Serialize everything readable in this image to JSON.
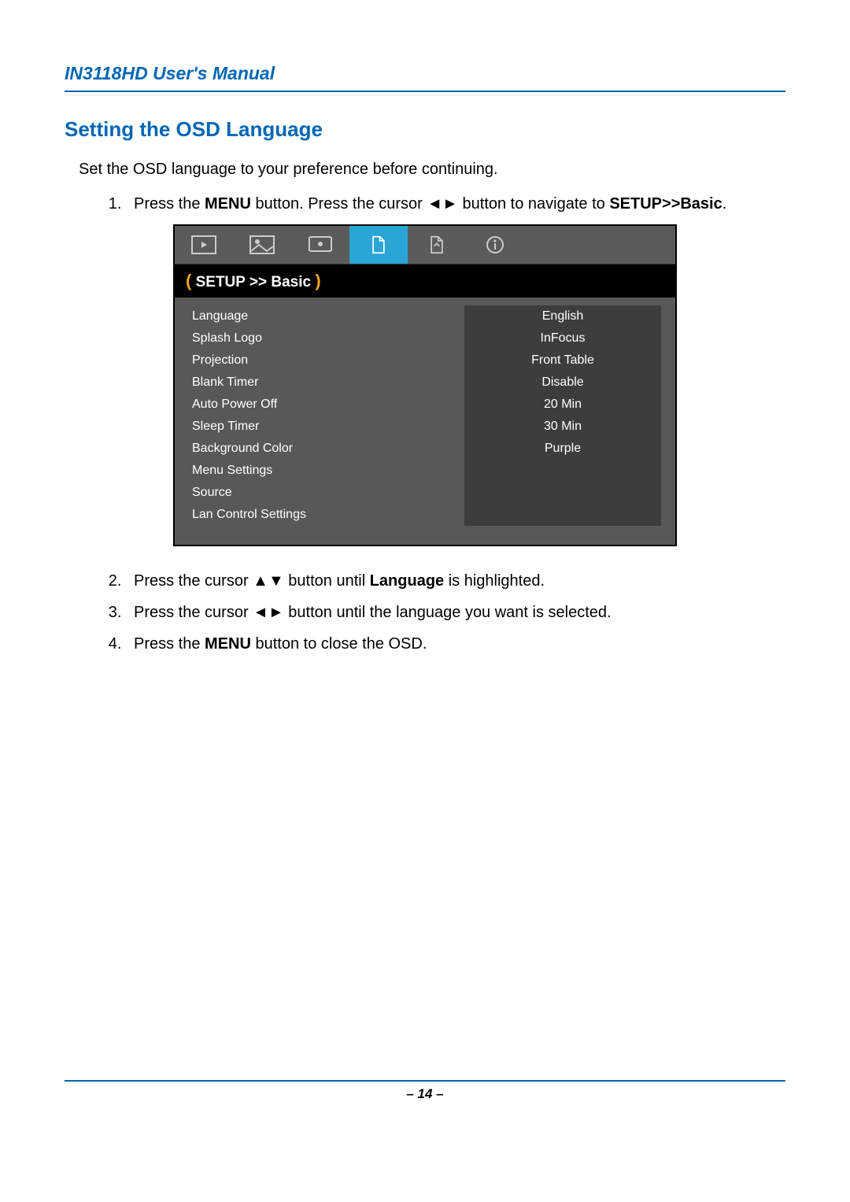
{
  "header": {
    "title": "IN3118HD User's Manual"
  },
  "section": {
    "title": "Setting the OSD Language"
  },
  "intro": "Set the OSD language to your preference before continuing.",
  "steps": {
    "s1_a": "Press the ",
    "s1_b": "MENU",
    "s1_c": " button. Press the cursor ◄► button to navigate to ",
    "s1_d": "SETUP>>Basic",
    "s1_e": ".",
    "s2_a": "Press the cursor ▲▼ button until ",
    "s2_b": "Language",
    "s2_c": " is highlighted.",
    "s3": "Press the cursor ◄► button until the language you want is selected.",
    "s4_a": "Press the ",
    "s4_b": "MENU",
    "s4_c": " button to close the OSD."
  },
  "osd": {
    "breadcrumb": "SETUP >> Basic",
    "left": [
      "Language",
      "Splash Logo",
      "Projection",
      "Blank Timer",
      "Auto Power Off",
      "Sleep Timer",
      "Background Color",
      "Menu Settings",
      "Source",
      "Lan Control Settings"
    ],
    "right": [
      "English",
      "InFocus",
      "Front Table",
      "Disable",
      "20 Min",
      "30 Min",
      "Purple"
    ]
  },
  "footer": {
    "page": "– 14 –"
  }
}
